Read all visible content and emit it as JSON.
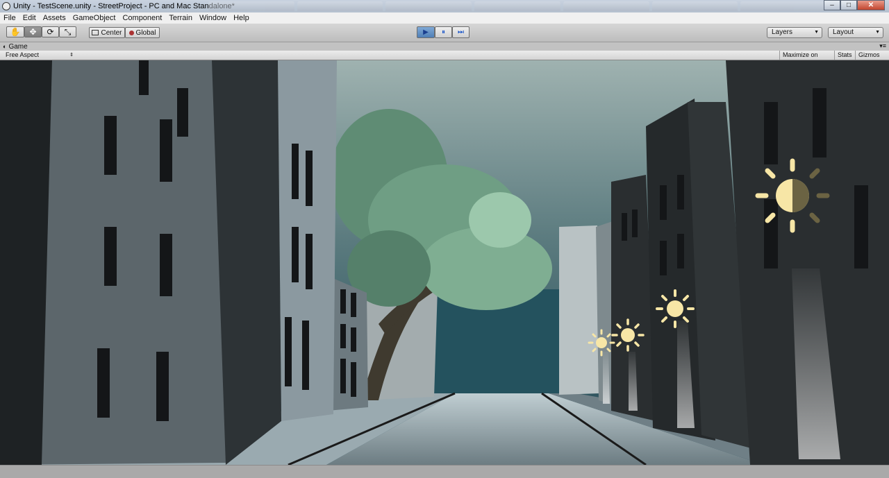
{
  "window": {
    "title": "Unity - TestScene.unity - StreetProject - PC and Mac Standalone*",
    "controls": {
      "minimize": "–",
      "maximize": "□",
      "close": "✕"
    }
  },
  "menu": [
    "File",
    "Edit",
    "Assets",
    "GameObject",
    "Component",
    "Terrain",
    "Window",
    "Help"
  ],
  "toolbar": {
    "tools": [
      {
        "name": "hand-tool",
        "icon": "hand-icon",
        "glyph": "✋"
      },
      {
        "name": "move-tool",
        "icon": "move-icon",
        "glyph": "✥"
      },
      {
        "name": "rotate-tool",
        "icon": "rotate-icon",
        "glyph": "⟳"
      },
      {
        "name": "scale-tool",
        "icon": "scale-icon",
        "glyph": "⤡"
      }
    ],
    "pivot_label": "Center",
    "space_label": "Global",
    "play_icon": "▶",
    "pause_icon": "⏸",
    "step_icon": "⏭",
    "layers_label": "Layers",
    "layout_label": "Layout"
  },
  "game_panel": {
    "tab_label": "Game",
    "aspect_label": "Free Aspect",
    "maximize_label": "Maximize on Play",
    "stats_label": "Stats",
    "gizmos_label": "Gizmos"
  },
  "scene": {
    "light_gizmo_icon": "sun-icon",
    "light_gizmo_color": "#f7e6a6",
    "sky_color": "#4b6e74",
    "road_color": "#8a9aa0"
  }
}
